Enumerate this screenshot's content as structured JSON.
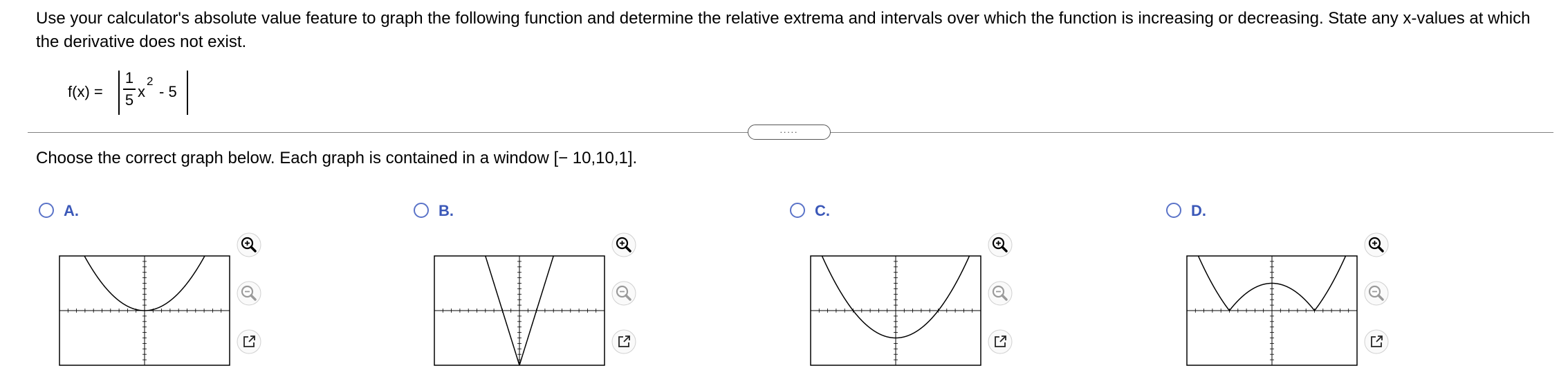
{
  "question": {
    "text": "Use your calculator's absolute value feature to graph the following function and determine the relative extrema and intervals over which the function is increasing or decreasing. State any x-values at which the derivative does not exist."
  },
  "formula": {
    "lhs": "f(x) =",
    "numerator": "1",
    "denominator": "5",
    "variable": "x",
    "exponent": "2",
    "rest": "- 5"
  },
  "divider_handle": ".....",
  "instruction": "Choose the correct graph below. Each graph is contained in a window [− 10,10,1].",
  "options": [
    {
      "label": "A."
    },
    {
      "label": "B."
    },
    {
      "label": "C."
    },
    {
      "label": "D."
    }
  ],
  "colors": {
    "accent": "#3b58b8",
    "radio_border": "#5a73c8",
    "divider": "#808080"
  },
  "icons": {
    "zoom_in": "zoom-in-icon",
    "zoom_out": "zoom-out-icon",
    "popout": "popout-icon"
  }
}
